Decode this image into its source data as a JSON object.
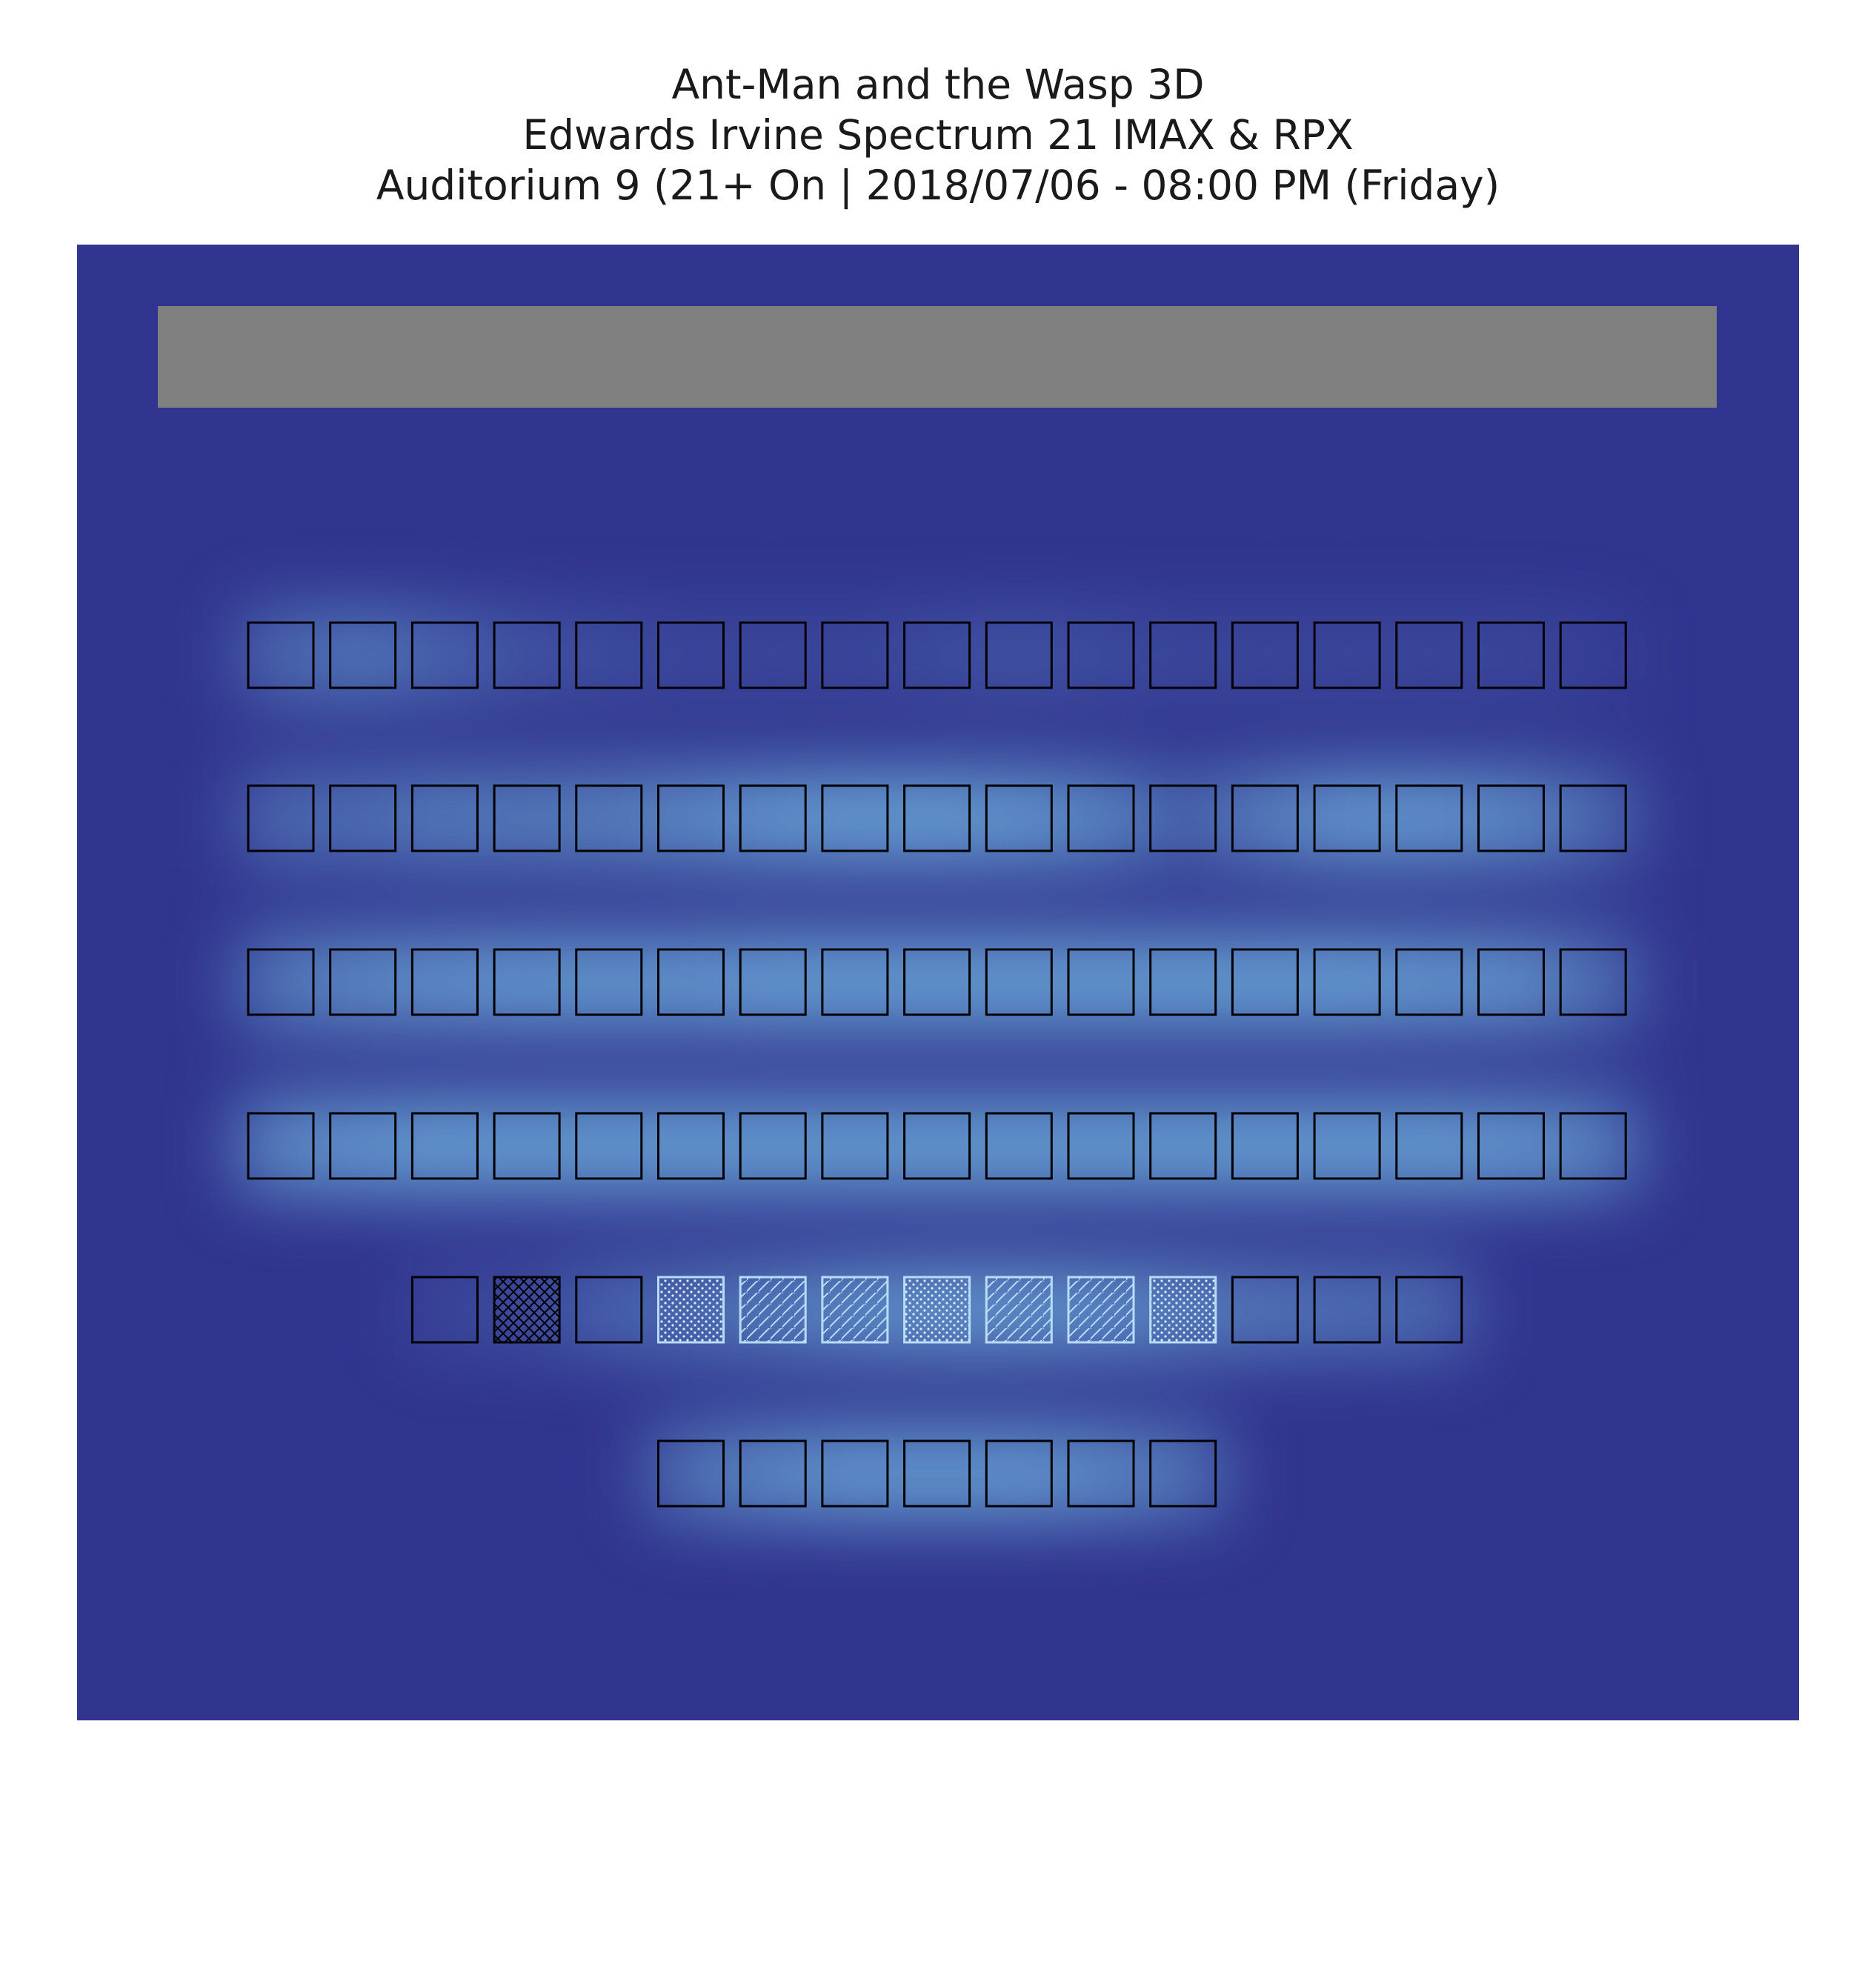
{
  "header": {
    "movie": "Ant-Man and the Wasp 3D",
    "theater": "Edwards Irvine Spectrum 21 IMAX & RPX",
    "session": "Auditorium 9 (21+ On | 2018/07/06 - 08:00 PM (Friday)"
  },
  "colors": {
    "background": "#31358f",
    "screen": "#808080",
    "seat_outline": "#000000",
    "heat_color": "#6aa6d6",
    "selected_outline": "#b8dcf5"
  },
  "seat_rows": [
    {
      "heat": [
        0.45,
        0.55,
        0.4,
        0.25,
        0.2,
        0.15,
        0.15,
        0.15,
        0.2,
        0.25,
        0.2,
        0.15,
        0.15,
        0.15,
        0.15,
        0.15,
        0.1
      ],
      "states": [
        "empty",
        "empty",
        "empty",
        "empty",
        "empty",
        "empty",
        "empty",
        "empty",
        "empty",
        "empty",
        "empty",
        "empty",
        "empty",
        "empty",
        "empty",
        "empty",
        "empty"
      ]
    },
    {
      "heat": [
        0.45,
        0.5,
        0.6,
        0.6,
        0.65,
        0.75,
        0.85,
        0.9,
        0.9,
        0.85,
        0.7,
        0.4,
        0.65,
        0.85,
        0.85,
        0.75,
        0.5
      ],
      "states": [
        "empty",
        "empty",
        "empty",
        "empty",
        "empty",
        "empty",
        "empty",
        "empty",
        "empty",
        "empty",
        "empty",
        "empty",
        "empty",
        "empty",
        "empty",
        "empty",
        "empty"
      ]
    },
    {
      "heat": [
        0.6,
        0.75,
        0.8,
        0.85,
        0.85,
        0.85,
        0.9,
        0.9,
        0.9,
        0.9,
        0.9,
        0.9,
        0.9,
        0.9,
        0.85,
        0.8,
        0.55
      ],
      "states": [
        "empty",
        "empty",
        "empty",
        "empty",
        "empty",
        "empty",
        "empty",
        "empty",
        "empty",
        "empty",
        "empty",
        "empty",
        "empty",
        "empty",
        "empty",
        "empty",
        "empty"
      ]
    },
    {
      "heat": [
        0.75,
        0.85,
        0.9,
        0.9,
        0.9,
        0.9,
        0.9,
        0.9,
        0.9,
        0.9,
        0.9,
        0.9,
        0.9,
        0.9,
        0.9,
        0.85,
        0.7
      ],
      "states": [
        "empty",
        "empty",
        "empty",
        "empty",
        "empty",
        "empty",
        "empty",
        "empty",
        "empty",
        "empty",
        "empty",
        "empty",
        "empty",
        "empty",
        "empty",
        "empty",
        "empty"
      ]
    },
    {
      "offset": 2,
      "heat": [
        0.15,
        0.2,
        0.4,
        0.5,
        0.6,
        0.75,
        0.8,
        0.8,
        0.75,
        0.65,
        0.55,
        0.5,
        0.45
      ],
      "states": [
        "empty",
        "crosshatch",
        "empty",
        "dotted",
        "hatched",
        "hatched",
        "dotted",
        "hatched",
        "hatched",
        "dotted",
        "empty",
        "empty",
        "empty"
      ]
    },
    {
      "offset": 5,
      "heat": [
        0.55,
        0.75,
        0.85,
        0.85,
        0.85,
        0.75,
        0.55
      ],
      "states": [
        "empty",
        "empty",
        "empty",
        "empty",
        "empty",
        "empty",
        "empty"
      ]
    }
  ]
}
